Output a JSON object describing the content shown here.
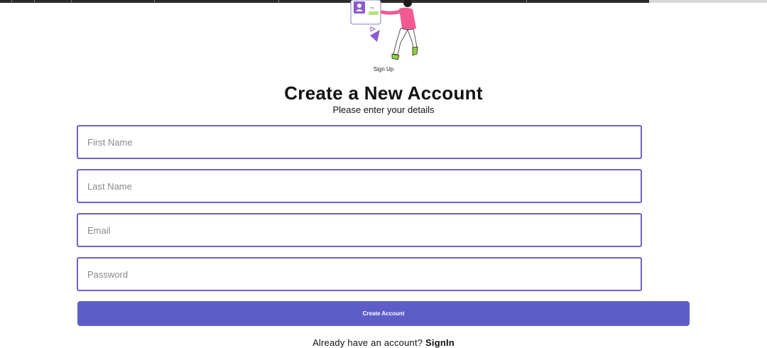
{
  "illustration": {
    "caption": "Sign Up",
    "badge_text": "••••",
    "colors": {
      "accent": "#8a5cd0",
      "shirt": "#f25a92",
      "shoes": "#8bd43a",
      "card_green": "#b6e27a"
    }
  },
  "heading": {
    "title": "Create a New Account",
    "subtitle": "Please enter your details"
  },
  "form": {
    "first_name": {
      "placeholder": "First Name",
      "value": ""
    },
    "last_name": {
      "placeholder": "Last Name",
      "value": ""
    },
    "email": {
      "placeholder": "Email",
      "value": ""
    },
    "password": {
      "placeholder": "Password",
      "value": ""
    },
    "submit_label": "Create Account"
  },
  "footer": {
    "prompt": "Already have an account?",
    "link_label": "SignIn"
  },
  "colors": {
    "field_border": "#6c64c4",
    "button_bg": "#5e5dc8",
    "button_text": "#ffffff"
  }
}
